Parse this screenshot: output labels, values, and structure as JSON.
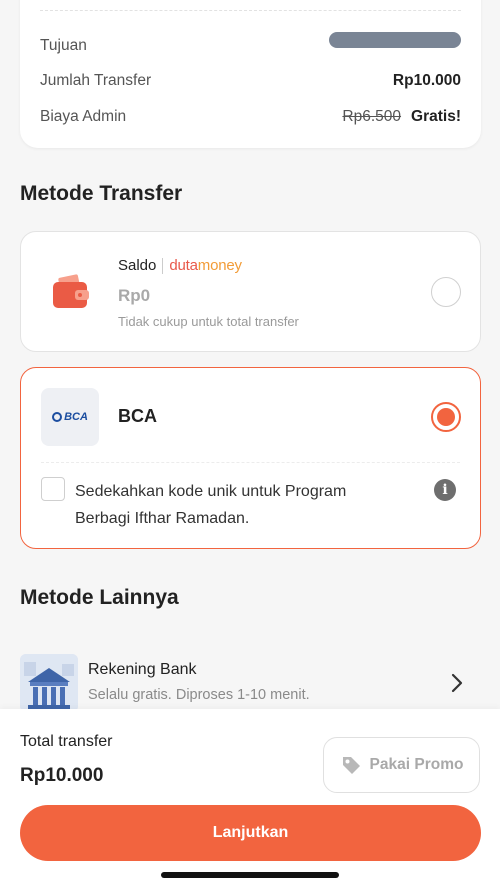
{
  "summary": {
    "rows": [
      {
        "label": "Tujuan",
        "value_redacted": true
      },
      {
        "label": "Jumlah Transfer",
        "value": "Rp10.000"
      },
      {
        "label": "Biaya Admin",
        "original_fee": "Rp6.500",
        "value": "Gratis!"
      }
    ]
  },
  "transfer_method": {
    "title": "Metode Transfer",
    "saldo": {
      "label": "Saldo",
      "brand_part1": "duta",
      "brand_part2": "money",
      "amount": "Rp0",
      "note": "Tidak cukup untuk total transfer",
      "selected": false
    },
    "bca": {
      "logo_text": "BCA",
      "name": "BCA",
      "selected": true,
      "sedekah_text": "Sedekahkan kode unik untuk Program Berbagi Ifthar Ramadan.",
      "sedekah_checked": false
    }
  },
  "other_methods": {
    "title": "Metode Lainnya",
    "items": [
      {
        "title": "Rekening Bank",
        "subtitle": "Selalu gratis. Diproses 1-10 menit.",
        "icon": "bank-building-icon"
      }
    ]
  },
  "footer": {
    "total_label": "Total transfer",
    "total_value": "Rp10.000",
    "promo_label": "Pakai Promo",
    "cta_label": "Lanjutkan"
  },
  "colors": {
    "accent": "#f2643f",
    "redaction": "#7a8595",
    "bca_blue": "#1c4ea0"
  }
}
